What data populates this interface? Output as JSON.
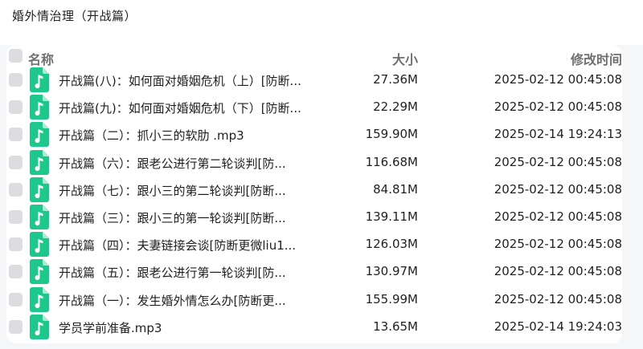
{
  "folder": {
    "title": "婚外情治理（开战篇）"
  },
  "columns": {
    "name": "名称",
    "size": "大小",
    "modified": "修改时间"
  },
  "icons": {
    "file_icon": "music-file-icon",
    "file_icon_color": "#1ec78c"
  },
  "files": [
    {
      "name": "开战篇(八)：如何面对婚姻危机（上）[防断...",
      "size": "27.36M",
      "modified": "2025-02-12 00:45:08"
    },
    {
      "name": "开战篇(九)：如何面对婚姻危机（下）[防断...",
      "size": "22.29M",
      "modified": "2025-02-12 00:45:08"
    },
    {
      "name": "开战篇（二）：抓小三的软肋 .mp3",
      "size": "159.90M",
      "modified": "2025-02-14 19:24:13"
    },
    {
      "name": "开战篇（六）：跟老公进行第二轮谈判[防...",
      "size": "116.68M",
      "modified": "2025-02-12 00:45:08"
    },
    {
      "name": "开战篇（七）：跟小三的第二轮谈判[防断...",
      "size": "84.81M",
      "modified": "2025-02-12 00:45:08"
    },
    {
      "name": "开战篇（三）：跟小三的第一轮谈判[防断...",
      "size": "139.11M",
      "modified": "2025-02-12 00:45:08"
    },
    {
      "name": "开战篇（四）：夫妻链接会谈[防断更微liu1...",
      "size": "126.03M",
      "modified": "2025-02-12 00:45:08"
    },
    {
      "name": "开战篇（五）：跟老公进行第一轮谈判[防...",
      "size": "130.97M",
      "modified": "2025-02-12 00:45:08"
    },
    {
      "name": "开战篇（一）：发生婚外情怎么办[防断更...",
      "size": "155.99M",
      "modified": "2025-02-12 00:45:08"
    },
    {
      "name": "学员学前准备.mp3",
      "size": "13.65M",
      "modified": "2025-02-14 19:24:03"
    }
  ]
}
